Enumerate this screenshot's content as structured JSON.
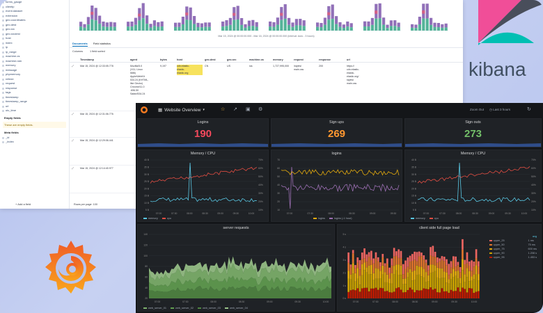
{
  "kibana": {
    "sidebar_fields": [
      "forms_gauge",
      "clientip",
      "event.dataset",
      "extension",
      "geo.coordinates",
      "geo.dest",
      "geo.src",
      "geo.srcdest",
      "host",
      "index",
      "ip",
      "ip_range",
      "machine.os",
      "machine.ram",
      "memory",
      "message",
      "phpmemory",
      "referer",
      "request",
      "response",
      "tags",
      "timestamp",
      "timestamp_range",
      "url",
      "utc_time"
    ],
    "empty_section_title": "Empty fields",
    "empty_msg": "These are empty fields.",
    "meta_section_title": "Meta fields",
    "meta_fields": [
      "_id",
      "_index"
    ],
    "add_field": "Add a field",
    "histogram_caption": "Mar 15, 2024 @ 00:00:00.000 - Mar 16, 2024 @ 00:00:00.000 (interval: Auto - 3 hours)",
    "tabs": [
      "Documents",
      "Field statistics"
    ],
    "toolbar": [
      "Columns",
      "1 field sorted"
    ],
    "columns": [
      "Timestamp",
      "agent",
      "bytes",
      "host",
      "geo.dest",
      "geo.src",
      "machine.os",
      "memory",
      "request",
      "response",
      "url"
    ],
    "rows": [
      {
        "time": "Mar 15, 2024 @ 12:33:05.778",
        "agent": "Mozilla/5.0\n(X11; Linux\ni686)\nAppleWebKit\n534.24 (KHTML,\nlike Gecko)\nChrome/11.0\n.696.50\nSafari/534.24",
        "bytes": "9,197",
        "host": "cdn.elastic-\nelastic-\nelastic.org",
        "geo_dest": "CN",
        "geo_src": "US",
        "os": "ios",
        "memory": "1,727,995,000",
        "request": "/styles/\nmain.css",
        "response": "200",
        "url": "https://\ncdn.elastic-\nelastic-\nelastic.org/\nstyles/\nmain.css"
      },
      {
        "time": "Mar 15, 2024 @ 12:31:06.776"
      },
      {
        "time": "Mar 15, 2024 @ 12:29:06.441"
      },
      {
        "time": "Mar 15, 2024 @ 12:14:40.977"
      }
    ],
    "footer": "Rows per page: 100"
  },
  "kibana_logo_text": "kibana",
  "grafana": {
    "dashboard_title": "Website Overview",
    "zoom_out": "Zoom Out",
    "time_range": "Last 3 hours",
    "stats": [
      {
        "title": "Logins",
        "value": "190",
        "color": "#f2495c"
      },
      {
        "title": "Sign ups",
        "value": "269",
        "color": "#ff9830"
      },
      {
        "title": "Sign outs",
        "value": "273",
        "color": "#73bf69"
      }
    ],
    "panels": {
      "memory_cpu_1": {
        "title": "Memory / CPU",
        "legend": [
          "memory",
          "cpu"
        ],
        "yleft": [
          "40 B",
          "35 B",
          "30 B",
          "25 B",
          "20 B",
          "15 B",
          "10 B",
          "5 B"
        ],
        "yright": [
          "70%",
          "60%",
          "50%",
          "40%",
          "30%",
          "20%",
          "10%"
        ],
        "xticks": [
          "07:00",
          "07:30",
          "08:00",
          "08:30",
          "09:00",
          "09:30",
          "10:00"
        ]
      },
      "logins": {
        "title": "logins",
        "legend": [
          "logins",
          "logins (-1 hour)"
        ],
        "yleft": [
          "70",
          "60",
          "50",
          "40",
          "30",
          "20",
          "10"
        ],
        "xticks": [
          "07:00",
          "07:30",
          "08:00",
          "08:30",
          "09:00",
          "09:30"
        ]
      },
      "memory_cpu_2": {
        "title": "Memory / CPU",
        "legend": [
          "memory",
          "cpu"
        ],
        "yleft": [
          "40 B",
          "35 B",
          "30 B",
          "25 B",
          "20 B",
          "15 B",
          "10 B",
          "5 B"
        ],
        "yright": [
          "70%",
          "60%",
          "50%",
          "40%",
          "30%",
          "20%",
          "10%"
        ],
        "xticks": [
          "07:00",
          "07:30",
          "08:00",
          "08:30",
          "09:00",
          "09:30",
          "10:00"
        ]
      },
      "server_requests": {
        "title": "server requests",
        "legend": [
          "web_server_01",
          "web_server_02",
          "web_server_03",
          "web_server_04"
        ],
        "yleft": [
          "140",
          "120",
          "100",
          "80",
          "60",
          "40",
          "20"
        ],
        "xticks": [
          "07:00",
          "07:30",
          "08:00",
          "08:30",
          "09:00",
          "09:30",
          "10:00"
        ]
      },
      "page_load": {
        "title": "client side full page load",
        "legend_header": "avg",
        "legend": [
          {
            "name": "upper_25",
            "avg": "1 ms"
          },
          {
            "name": "upper_50",
            "avg": "75 ms"
          },
          {
            "name": "upper_75",
            "avg": "600 ms"
          },
          {
            "name": "upper_90",
            "avg": "1.208 s"
          },
          {
            "name": "upper_95",
            "avg": "1.453 s"
          }
        ],
        "yleft": [
          "5 s",
          "4 s",
          "3 s",
          "2 s",
          "1 s",
          "0 s"
        ],
        "xticks": [
          "07:00",
          "07:30",
          "08:00",
          "08:30",
          "09:00",
          "09:30",
          "10:00"
        ]
      }
    }
  },
  "colors": {
    "grafana_bg": "#141619",
    "panel_bg": "#1f2226",
    "kibana_blue": "#006bb8",
    "hist_purple": "#9170b8",
    "hist_teal": "#54b399"
  }
}
